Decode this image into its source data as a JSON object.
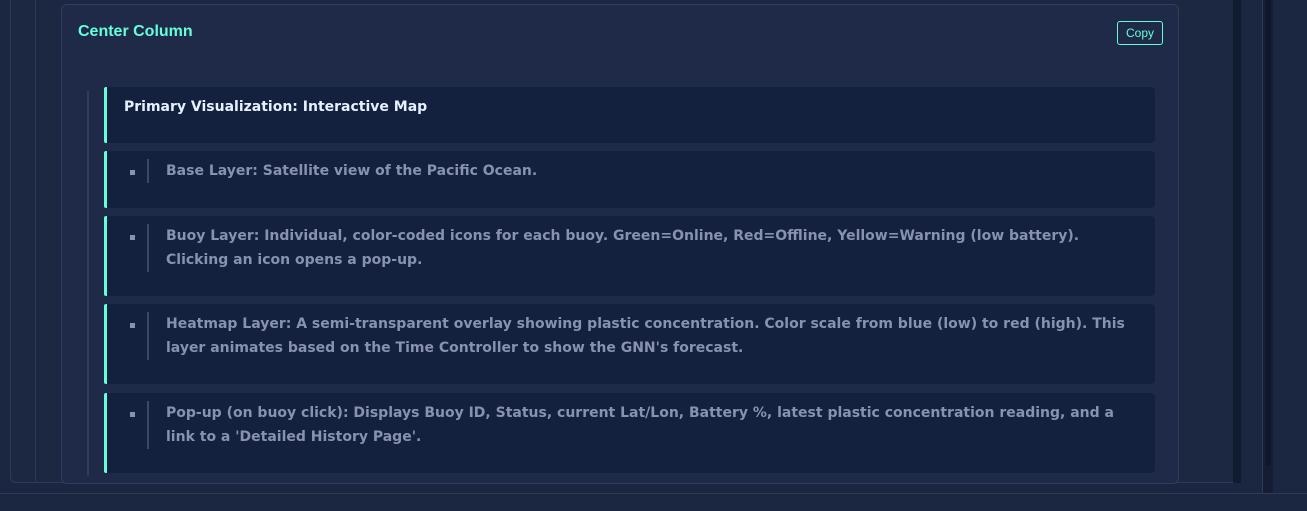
{
  "card": {
    "title": "Center Column",
    "copy_label": "Copy"
  },
  "sections": {
    "header": "Primary Visualization: Interactive Map",
    "items": [
      {
        "text": "Base Layer: Satellite view of the Pacific Ocean."
      },
      {
        "text": "Buoy Layer: Individual, color-coded icons for each buoy. Green=Online, Red=Offline, Yellow=Warning (low battery). Clicking an icon opens a pop-up."
      },
      {
        "text": "Heatmap Layer: A semi-transparent overlay showing plastic concentration. Color scale from blue (low) to red (high). This layer animates based on the Time Controller to show the GNN's forecast."
      },
      {
        "text": "Pop-up (on buoy click): Displays Buoy ID, Status, current Lat/Lon, Battery %, latest plastic concentration reading, and a link to a 'Detailed History Page'."
      }
    ]
  },
  "colors": {
    "accent": "#64ffda",
    "background": "#1b2640",
    "panel": "#1e2a47",
    "item_bg": "#13213e",
    "muted_text": "#8892b0",
    "header_text": "#e6f0ff"
  }
}
